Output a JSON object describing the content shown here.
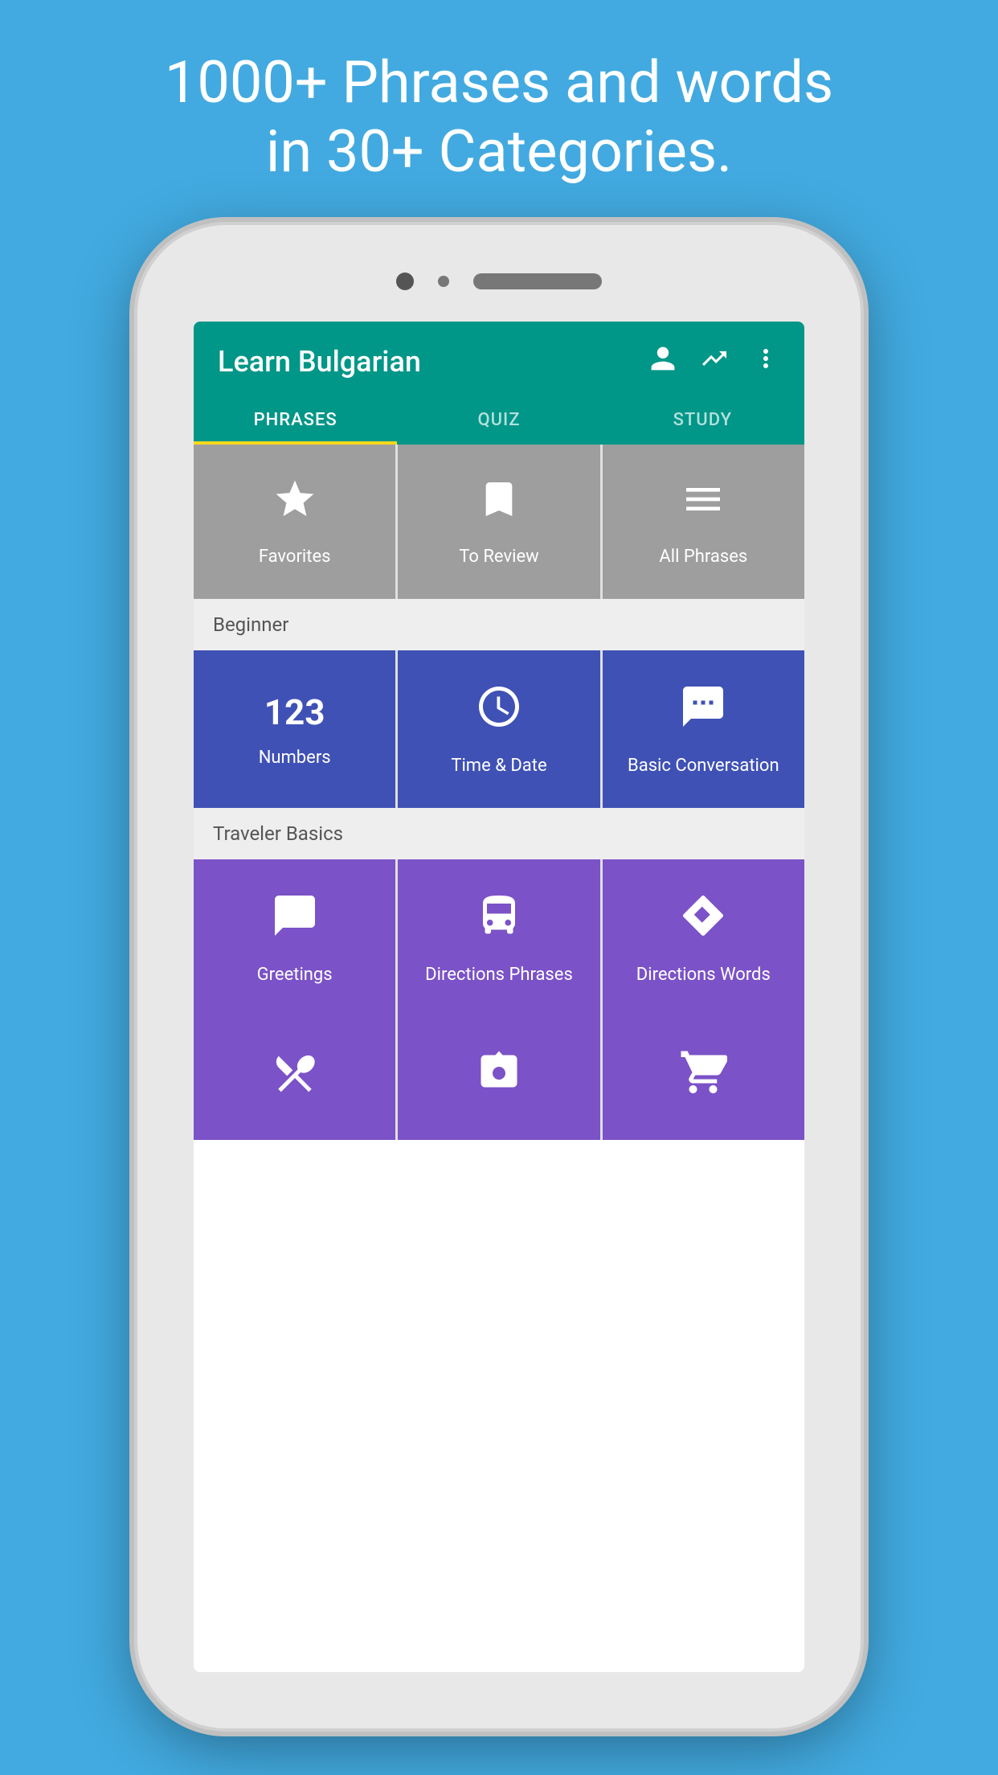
{
  "hero": {
    "line1": "1000+ Phrases and words",
    "line2": "in 30+ Categories."
  },
  "app": {
    "title": "Learn Bulgarian",
    "tabs": [
      {
        "id": "phrases",
        "label": "PHRASES",
        "active": true
      },
      {
        "id": "quiz",
        "label": "QUIZ",
        "active": false
      },
      {
        "id": "study",
        "label": "STUDY",
        "active": false
      }
    ],
    "toolbar_icons": [
      "person",
      "trending_up",
      "more_vert"
    ],
    "top_grid": [
      {
        "id": "favorites",
        "label": "Favorites",
        "icon": "star",
        "color": "gray"
      },
      {
        "id": "to-review",
        "label": "To Review",
        "icon": "bookmark",
        "color": "gray"
      },
      {
        "id": "all-phrases",
        "label": "All Phrases",
        "icon": "menu",
        "color": "gray"
      }
    ],
    "section_beginner": "Beginner",
    "beginner_grid": [
      {
        "id": "numbers",
        "label": "Numbers",
        "icon": "numbers",
        "color": "blue"
      },
      {
        "id": "time-date",
        "label": "Time & Date",
        "icon": "clock",
        "color": "blue"
      },
      {
        "id": "basic-conversation",
        "label": "Basic Conversation",
        "icon": "chat",
        "color": "blue"
      }
    ],
    "section_traveler": "Traveler Basics",
    "traveler_grid": [
      {
        "id": "greetings",
        "label": "Greetings",
        "icon": "speech",
        "color": "purple"
      },
      {
        "id": "directions-phrases",
        "label": "Directions Phrases",
        "icon": "bus",
        "color": "purple"
      },
      {
        "id": "directions-words",
        "label": "Directions Words",
        "icon": "direction",
        "color": "purple"
      }
    ],
    "bottom_grid": [
      {
        "id": "food",
        "label": "",
        "icon": "utensils",
        "color": "purple"
      },
      {
        "id": "photos",
        "label": "",
        "icon": "camera",
        "color": "purple"
      },
      {
        "id": "shopping",
        "label": "",
        "icon": "cart",
        "color": "purple"
      }
    ]
  }
}
